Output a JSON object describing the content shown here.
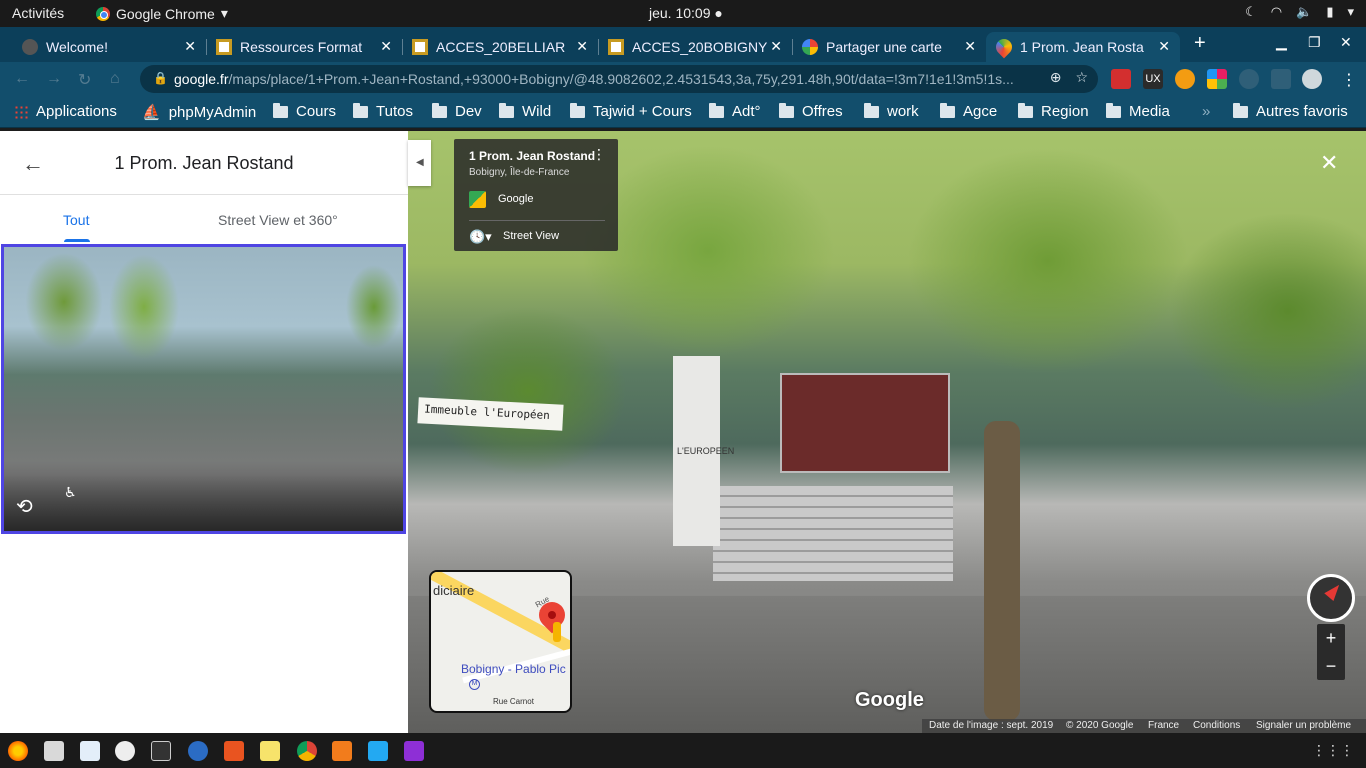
{
  "topbar": {
    "activities": "Activités",
    "app_name": "Google Chrome",
    "clock": "jeu. 10:09"
  },
  "tabs": [
    {
      "title": "Welcome!",
      "favicon": "vscode-icon",
      "active": false
    },
    {
      "title": "Ressources Format",
      "favicon": "sheet-icon",
      "active": false
    },
    {
      "title": "ACCES_20BELLIAR",
      "favicon": "sheet-icon",
      "active": false
    },
    {
      "title": "ACCES_20BOBIGNY",
      "favicon": "sheet-icon",
      "active": false
    },
    {
      "title": "Partager une carte",
      "favicon": "google-icon",
      "active": false
    },
    {
      "title": "1 Prom. Jean Rosta",
      "favicon": "maps-icon",
      "active": true
    }
  ],
  "omnibox": {
    "host": "google.fr",
    "path": "/maps/place/1+Prom.+Jean+Rostand,+93000+Bobigny/@48.9082602,2.4531543,3a,75y,291.48h,90t/data=!3m7!1e1!3m5!1s..."
  },
  "bookmarks": [
    {
      "label": "Applications",
      "icon": "apps-grid-icon"
    },
    {
      "label": "phpMyAdmin",
      "icon": "phpmyadmin-icon"
    },
    {
      "label": "Cours",
      "icon": "folder-icon"
    },
    {
      "label": "Tutos",
      "icon": "folder-icon"
    },
    {
      "label": "Dev",
      "icon": "folder-icon"
    },
    {
      "label": "Wild",
      "icon": "folder-icon"
    },
    {
      "label": "Tajwid + Cours",
      "icon": "folder-icon"
    },
    {
      "label": "Adt°",
      "icon": "folder-icon"
    },
    {
      "label": "Offres",
      "icon": "folder-icon"
    },
    {
      "label": "work",
      "icon": "folder-icon"
    },
    {
      "label": "Agce",
      "icon": "folder-icon"
    },
    {
      "label": "Region",
      "icon": "folder-icon"
    },
    {
      "label": "Media",
      "icon": "folder-icon"
    }
  ],
  "bookmarks_overflow": "»",
  "other_bookmarks": "Autres favoris",
  "sidepanel": {
    "title": "1 Prom. Jean Rostand",
    "tabs": [
      "Tout",
      "Street View et 360°"
    ]
  },
  "streetview": {
    "sign_text": "Immeuble l'Européen",
    "totem_text": "L'EUROPEEN",
    "card": {
      "title": "1 Prom. Jean Rostand",
      "subtitle": "Bobigny, Île-de-France",
      "source": "Google",
      "mode": "Street View"
    },
    "minimap": {
      "label_left": "diciaire",
      "street_top": "Rue Rene",
      "station": "Bobigny - Pablo Pic",
      "street_bottom": "Rue Carnot",
      "metro": "M"
    },
    "watermark": "Google",
    "footer": {
      "image_date": "Date de l'image : sept. 2019",
      "copyright": "© 2020 Google",
      "country": "France",
      "terms": "Conditions",
      "report": "Signaler un problème"
    },
    "zoom_in": "+",
    "zoom_out": "−"
  },
  "colors": {
    "tabstrip": "#0c3f5a",
    "toolbar": "#124e6c",
    "accent": "#1a73e8",
    "selection_border": "#4f45e3"
  }
}
